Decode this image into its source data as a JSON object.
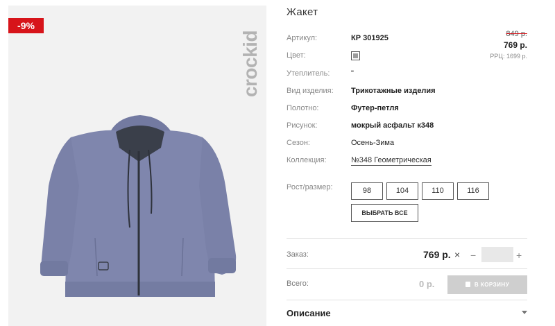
{
  "photo": {
    "discount": "-9%",
    "brand": "crockid"
  },
  "product": {
    "title": "Жакет"
  },
  "specs": [
    {
      "label": "Артикул:",
      "value": "КР 301925"
    },
    {
      "label": "Цвет:",
      "value": ""
    },
    {
      "label": "Утеплитель:",
      "value": "\""
    },
    {
      "label": "Вид изделия:",
      "value": "Трикотажные изделия"
    },
    {
      "label": "Полотно:",
      "value": "Футер-петля"
    },
    {
      "label": "Рисунок:",
      "value": "мокрый асфальт к348"
    },
    {
      "label": "Сезон:",
      "value": "Осень-Зима"
    },
    {
      "label": "Коллекция:",
      "value": "№348 Геометрическая"
    }
  ],
  "price": {
    "old": "849 р.",
    "new": "769 р.",
    "rrp": "РРЦ: 1699 р."
  },
  "sizes": {
    "label": "Рост/размер:",
    "options": [
      "98",
      "104",
      "110",
      "116"
    ],
    "select_all": "ВЫБРАТЬ ВСЕ"
  },
  "order": {
    "label": "Заказ:",
    "price": "769 р.",
    "times": "×",
    "minus": "−",
    "plus": "+",
    "quantity": ""
  },
  "total": {
    "label": "Всего:",
    "value": "0 р.",
    "cart_button": "В КОРЗИНУ"
  },
  "description": {
    "title": "Описание"
  },
  "colors": {
    "accent": "#d7141a",
    "jacket": "#7f86ad",
    "hood_lining": "#3a3f4a"
  }
}
